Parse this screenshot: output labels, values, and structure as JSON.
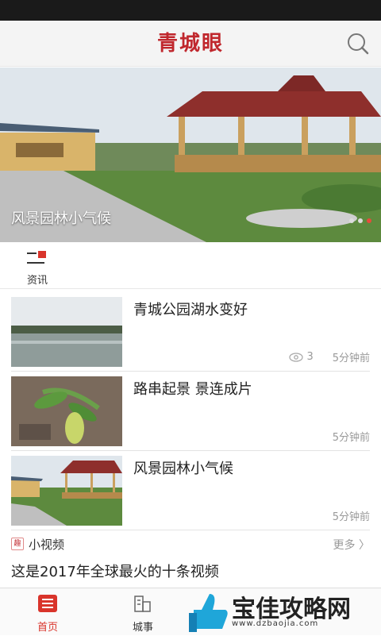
{
  "header": {
    "title": "青城眼"
  },
  "banner": {
    "caption": "风景园林小气候"
  },
  "channel": {
    "label": "资讯"
  },
  "news": [
    {
      "title": "青城公园湖水变好",
      "views": "3",
      "time": "5分钟前"
    },
    {
      "title": "路串起景 景连成片",
      "time": "5分钟前"
    },
    {
      "title": "风景园林小气候",
      "time": "5分钟前"
    }
  ],
  "video": {
    "section_title": "小视频",
    "more_label": "更多 〉",
    "title": "这是2017年全球最火的十条视频",
    "icon_text": "趣"
  },
  "tabs": [
    {
      "label": "首页"
    },
    {
      "label": "城事"
    }
  ],
  "watermark": {
    "text": "宝佳攻略网",
    "url": "www.dzbaojia.com"
  },
  "colors": {
    "accent": "#c0272d",
    "active_tab": "#d9342b"
  }
}
